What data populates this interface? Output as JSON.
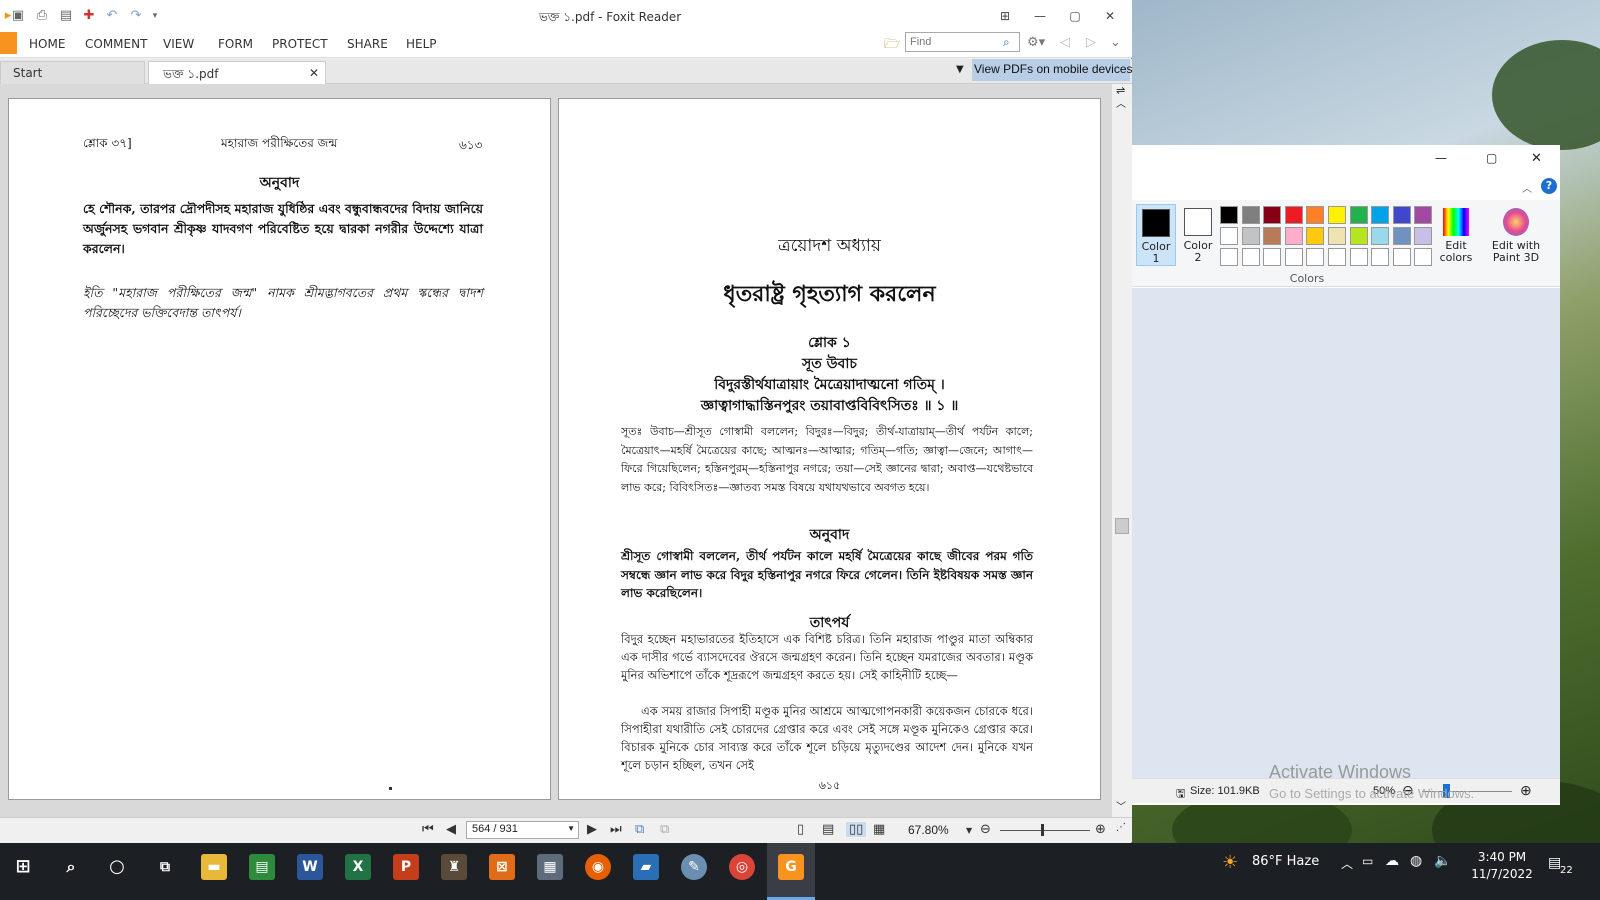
{
  "foxit": {
    "title": "ভক্ত ১.pdf - Foxit Reader",
    "menu": [
      "HOME",
      "COMMENT",
      "VIEW",
      "FORM",
      "PROTECT",
      "SHARE",
      "HELP"
    ],
    "find_placeholder": "Find",
    "tabs": [
      {
        "label": "Start"
      },
      {
        "label": "ভক্ত ১.pdf"
      }
    ],
    "mobile_banner": "View PDFs on mobile devices",
    "page_indicator": "564 / 931",
    "zoom": "67.80%"
  },
  "left_page": {
    "header_left": "শ্লোক ৩৭]",
    "header_center": "মহারাজ পরীক্ষিতের জন্ম",
    "header_right": "৬১৩",
    "section_title": "অনুবাদ",
    "paragraph": "হে শৌনক, তারপর দ্রৌপদীসহ মহারাজ যুধিষ্ঠির এবং বন্ধুবান্ধবদের বিদায় জানিয়ে অর্জুনসহ ভগবান শ্রীকৃষ্ণ যাদবগণ পরিবেষ্টিত হয়ে দ্বারকা নগরীর উদ্দেশ্যে যাত্রা করলেন।",
    "closing": "ইতি \"মহারাজ পরীক্ষিতের জন্ম\" নামক শ্রীমদ্ভাগবতের প্রথম স্কন্ধের দ্বাদশ পরিচ্ছেদের ভক্তিবেদান্ত তাৎপর্য।"
  },
  "right_page": {
    "chapter": "ত্রয়োদশ অধ্যায়",
    "title": "ধৃতরাষ্ট্র গৃহত্যাগ করলেন",
    "verse_label": "শ্লোক ১",
    "verse_speaker": "সূত উবাচ",
    "verse_line1": "বিদুরস্তীর্থযাত্রায়াং মৈত্রেয়াদাত্মনো গতিম্ ।",
    "verse_line2": "জ্ঞাত্বাগাদ্ধাস্তিনপুরং তয়াবাপ্তবিবিৎসিতঃ ॥ ১ ॥",
    "synonyms": "সূতঃ উবাচ—শ্রীসূত গোস্বামী বললেন; বিদুরঃ—বিদুর; তীর্থ-যাত্রায়াম্—তীর্থ পর্যটন কালে; মৈত্রেয়াৎ—মহর্ষি মৈত্রেয়ের কাছে; আত্মনঃ—আত্মার; গতিম্—গতি; জ্ঞাত্বা—জেনে; আগাৎ—ফিরে গিয়েছিলেন; হস্তিনপুরম্—হস্তিনাপুর নগরে; তয়া—সেই জ্ঞানের দ্বারা; অবাপ্ত—যথেষ্টভাবে লাভ করে; বিবিৎসিতঃ—জ্ঞাতব্য সমস্ত বিষয়ে যথাযথভাবে অবগত হয়ে।",
    "translation_label": "অনুবাদ",
    "translation": "শ্রীসূত গোস্বামী বললেন, তীর্থ পর্যটন কালে মহর্ষি মৈত্রেয়ের কাছে জীবের পরম গতি সম্বন্ধে জ্ঞান লাভ করে বিদুর হস্তিনাপুর নগরে ফিরে গেলেন। তিনি ইষ্টবিষয়ক সমস্ত জ্ঞান লাভ করেছিলেন।",
    "purport_label": "তাৎপর্য",
    "purport1": "বিদুর হচ্ছেন মহাভারতের ইতিহাসে এক বিশিষ্ট চরিত্র। তিনি মহারাজ পাণ্ডুর মাতা অম্বিকার এক দাসীর গর্ভে ব্যাসদেবের ঔরসে জন্মগ্রহণ করেন। তিনি হচ্ছেন যমরাজের অবতার। মণ্ডূক মুনির অভিশাপে তাঁকে শূদ্ররূপে জন্মগ্রহণ করতে হয়। সেই কাহিনীটি হচ্ছে—",
    "purport2": "এক সময় রাজার সিপাহী মণ্ডূক মুনির আশ্রমে আত্মগোপনকারী কয়েকজন চোরকে ধরে। সিপাহীরা যথারীতি সেই চোরদের গ্রেপ্তার করে এবং সেই সঙ্গে মণ্ডূক মুনিকেও গ্রেপ্তার করে। বিচারক মুনিকে চোর সাব্যস্ত করে তাঁকে শূলে চড়িয়ে মৃত্যুদণ্ডের আদেশ দেন। মুনিকে যখন শূলে চড়ান হচ্ছিল, তখন সেই",
    "page_number": "৬১৫"
  },
  "paint": {
    "color1": "Color\n1",
    "color2": "Color\n2",
    "colors_label": "Colors",
    "edit_colors": "Edit\ncolors",
    "edit_3d": "Edit with\nPaint 3D",
    "size": "Size: 101.9KB",
    "zoom": "50%",
    "palette": [
      "#000000",
      "#7f7f7f",
      "#880015",
      "#ed1c24",
      "#ff7f27",
      "#fff200",
      "#22b14c",
      "#00a2e8",
      "#3f48cc",
      "#a349a4",
      "#ffffff",
      "#c3c3c3",
      "#b97a57",
      "#ffaec9",
      "#ffc90e",
      "#efe4b0",
      "#b5e61d",
      "#99d9ea",
      "#7092be",
      "#c8bfe7"
    ]
  },
  "watermark": {
    "title": "Activate Windows",
    "sub": "Go to Settings to activate Windows."
  },
  "taskbar": {
    "weather": "86°F  Haze",
    "time": "3:40 PM",
    "date": "11/7/2022",
    "notifications": "22"
  }
}
